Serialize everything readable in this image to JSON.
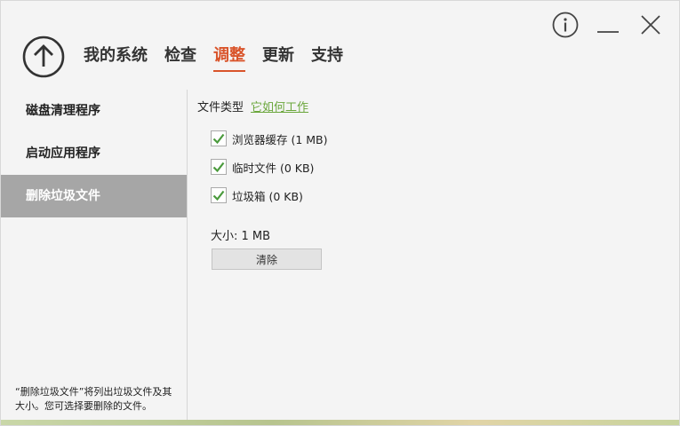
{
  "window": {
    "controls": [
      "info-icon",
      "minimize-icon",
      "close-icon"
    ]
  },
  "nav": {
    "back_icon": "arrow-up-circle-icon",
    "tabs": [
      {
        "label": "我的系统",
        "active": false
      },
      {
        "label": "检查",
        "active": false
      },
      {
        "label": "调整",
        "active": true
      },
      {
        "label": "更新",
        "active": false
      },
      {
        "label": "支持",
        "active": false
      }
    ]
  },
  "sidebar": {
    "items": [
      {
        "label": "磁盘清理程序",
        "active": false
      },
      {
        "label": "启动应用程序",
        "active": false
      },
      {
        "label": "删除垃圾文件",
        "active": true
      }
    ],
    "description": "“删除垃圾文件”将列出垃圾文件及其大小。您可选择要删除的文件。"
  },
  "content": {
    "file_type_label": "文件类型",
    "how_link": "它如何工作",
    "items": [
      {
        "label": "浏览器缓存 (1 MB)",
        "checked": true
      },
      {
        "label": "临时文件 (0 KB)",
        "checked": true
      },
      {
        "label": "垃圾箱 (0 KB)",
        "checked": true
      }
    ],
    "size_label": "大小: 1 MB",
    "clean_button": "清除"
  },
  "colors": {
    "accent": "#d9542a",
    "link": "#6aa63b",
    "check": "#4a9a3c",
    "sidebar_active": "#a6a6a6"
  }
}
